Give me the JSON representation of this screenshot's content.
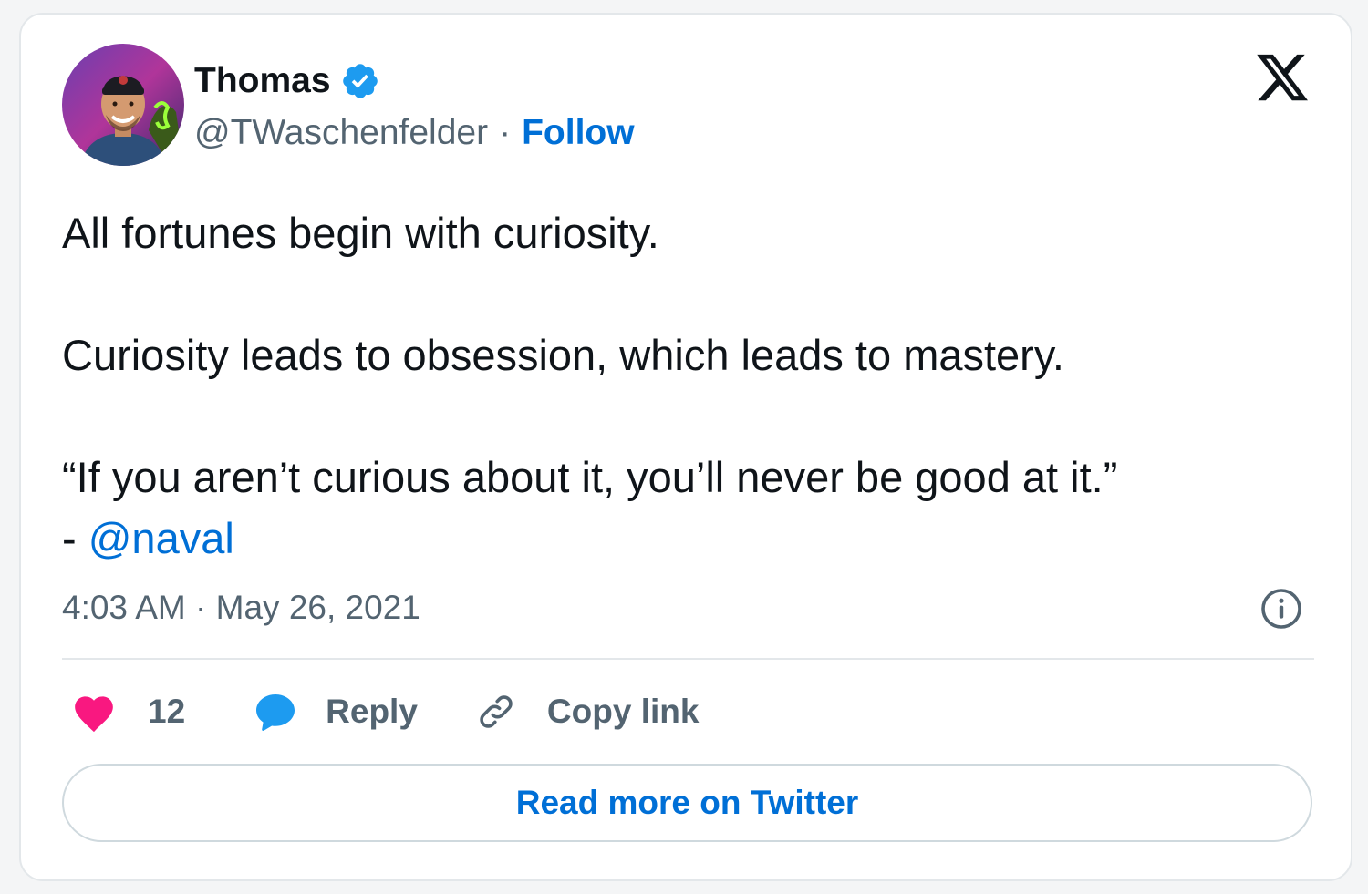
{
  "author": {
    "display_name": "Thomas",
    "handle": "@TWaschenfelder",
    "separator": "·",
    "follow_label": "Follow",
    "verified": true
  },
  "tweet": {
    "lines": [
      "All fortunes begin with curiosity.",
      "Curiosity leads to obsession, which leads to mastery.",
      "“If you aren’t curious about it, you’ll never be good at it.”"
    ],
    "attribution_prefix": "- ",
    "mention": "@naval"
  },
  "timestamp": {
    "time": "4:03 AM",
    "separator": "·",
    "date": "May 26, 2021"
  },
  "actions": {
    "like_count": "12",
    "reply_label": "Reply",
    "copy_link_label": "Copy link"
  },
  "read_more_label": "Read more on Twitter",
  "icons": {
    "platform_logo": "x-logo-icon",
    "verified": "verified-badge-icon",
    "info": "info-icon",
    "like": "heart-icon",
    "reply": "speech-bubble-icon",
    "copy_link": "link-icon"
  },
  "colors": {
    "link_blue": "#006fd6",
    "verified_blue": "#1d9bf0",
    "heart_pink": "#f91880",
    "reply_blue": "#1d9bf0",
    "text_secondary": "#536471"
  }
}
